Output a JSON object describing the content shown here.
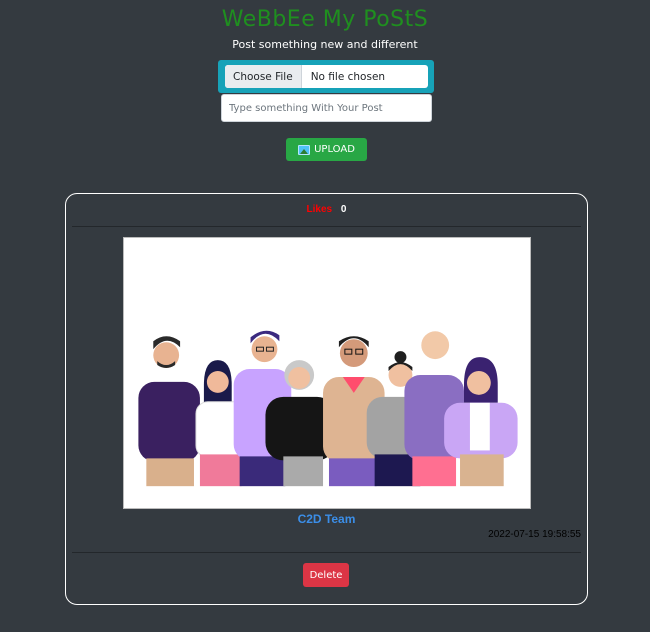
{
  "header": {
    "title": "WeBbEe My PoStS",
    "subtitle": "Post something new and different"
  },
  "form": {
    "choose_file_label": "Choose File",
    "file_status": "No file chosen",
    "post_placeholder": "Type something With Your Post",
    "upload_label": "UPLOAD",
    "upload_icon": "image-icon"
  },
  "post": {
    "likes_label": "Likes",
    "likes_count": "0",
    "image_icon": "team-illustration",
    "text": "C2D Team",
    "timestamp": "2022-07-15 19:58:55",
    "delete_label": "Delete"
  },
  "colors": {
    "background": "#343a40",
    "title": "#1f8f1f",
    "file_wrap": "#17a2b8",
    "upload": "#28a745",
    "delete": "#dc3545",
    "likes": "#ff0000",
    "post_text": "#3b8ee8"
  }
}
